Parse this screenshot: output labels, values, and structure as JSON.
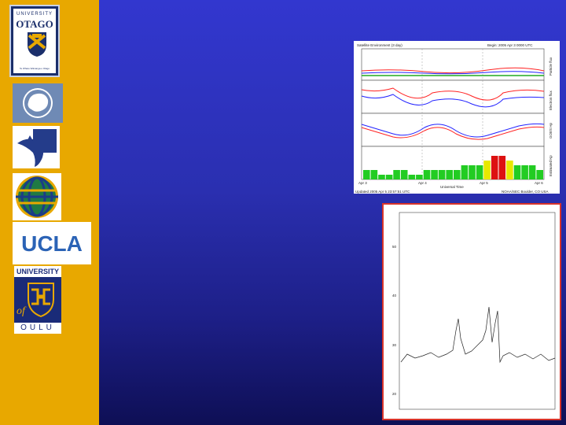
{
  "sidebar": {
    "logos": [
      {
        "name": "university-of-otago-logo",
        "text_top": "UNIVERSITY",
        "text_main": "OTAGO",
        "motto": "Te Whare Wānanga o Otāgo"
      },
      {
        "name": "antarctica-logo"
      },
      {
        "name": "dolphin-logo"
      },
      {
        "name": "globe-logo"
      },
      {
        "name": "ucla-logo",
        "text": "UCLA"
      },
      {
        "name": "university-of-oulu-logo",
        "text_top": "UNIVERSITY",
        "text_of": "of",
        "text_bottom": "OULU"
      }
    ]
  },
  "goes_plot": {
    "title_left": "Satellite Environment (3 day)",
    "title_right": "Begin: 2005 Apr 3 0000 UTC",
    "x_ticks": [
      "Apr 3",
      "Apr 4",
      "Apr 5",
      "Apr 6"
    ],
    "x_label": "Universal Time",
    "footer_left": "Updated 2005 Apr 5 23:57:51 UTC",
    "footer_right": "NOAA/SEC Boulder, CO USA",
    "panel_labels": [
      "Particle flux",
      "Electron flux",
      "GOES Hp",
      "Estimated Kp"
    ],
    "kp_values": [
      2,
      2,
      1,
      1,
      2,
      2,
      1,
      1,
      2,
      2,
      2,
      2,
      2,
      3,
      3,
      3,
      4,
      5,
      5,
      4,
      3,
      3,
      3,
      2
    ],
    "colors": {
      "kp_low": "#22cc22",
      "kp_mid": "#e8e800",
      "kp_high": "#dd1111"
    }
  },
  "magnetometer_plot": {
    "title": "",
    "subtitle": "",
    "y_label": "",
    "y_ticks": [
      "20",
      "30",
      "40",
      "50",
      "60"
    ],
    "x_ticks": [
      "",
      "",
      ""
    ],
    "x_label": "",
    "border_color": "#d8332a"
  },
  "colors": {
    "sidebar": "#e8a800",
    "slide_top": "#3237cf",
    "slide_bottom": "#0e0f55"
  }
}
